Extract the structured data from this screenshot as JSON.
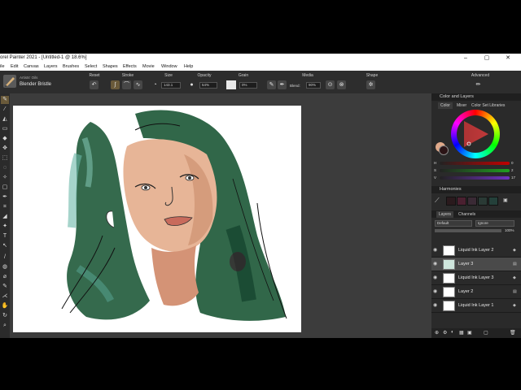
{
  "window": {
    "title": "orel Painter 2021 - [Untitled-1 @ 18.6%]",
    "controls": [
      "–",
      "▢",
      "✕"
    ]
  },
  "menu": [
    "ile",
    "Edit",
    "Canvas",
    "Layers",
    "Brushes",
    "Select",
    "Shapes",
    "Effects",
    "Movie",
    "Window",
    "Help"
  ],
  "propbar": {
    "brush_category": "Artists' Oils",
    "brush_variant": "Blender Bristle",
    "sections": {
      "reset": "Reset",
      "stroke": "Stroke",
      "size": "Size",
      "opacity": "Opacity",
      "grain": "Grain",
      "media": "Media",
      "shape": "Shape",
      "advanced": "Advanced"
    },
    "size_value": "143.1",
    "opacity_value": "54%",
    "grain_value": "0%",
    "blend_label": "Blend:",
    "blend_value": "90%"
  },
  "color_panel": {
    "header": "Color and Layers",
    "tabs": [
      "Color",
      "Mixer",
      "Color Set Libraries"
    ],
    "sliders": [
      {
        "label": "H",
        "value": "0"
      },
      {
        "label": "S",
        "value": "2"
      },
      {
        "label": "V",
        "value": "17"
      }
    ],
    "main_color": "#2b1416",
    "secondary_color": "#e0a98a"
  },
  "harmonies": {
    "header": "Harmonies",
    "swatches": [
      "#2a1a1d",
      "#4a2030",
      "#3a2a35",
      "#2a3a35",
      "#24403a",
      "#1a4a3a"
    ]
  },
  "layers_panel": {
    "tabs": [
      "Layers",
      "Channels"
    ],
    "composite_method": "Default",
    "preserve": "Ignore",
    "opacity": "100%",
    "layers": [
      {
        "name": "Liquid Ink Layer 2",
        "selected": false
      },
      {
        "name": "Layer 3",
        "selected": true
      },
      {
        "name": "Liquid Ink Layer 3",
        "selected": false
      },
      {
        "name": "Layer 2",
        "selected": false
      },
      {
        "name": "Liquid Ink Layer 1",
        "selected": false
      }
    ]
  },
  "colors": {
    "accent": "#e0a050",
    "hair_green": "#1f5a3a",
    "skin": "#e7b597"
  }
}
